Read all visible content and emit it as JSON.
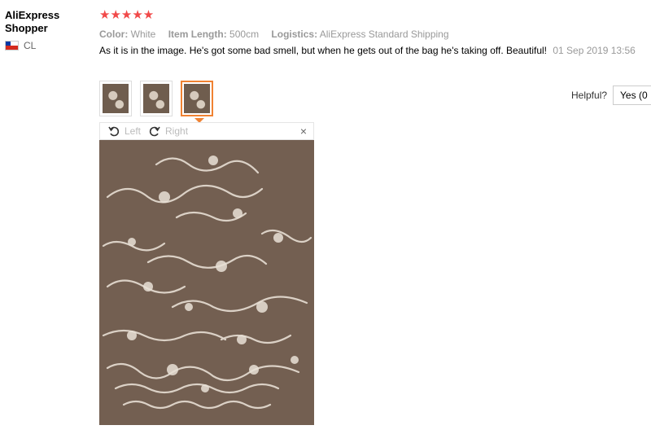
{
  "reviewer": {
    "name": "AliExpress Shopper",
    "country": "CL"
  },
  "review": {
    "stars": "★★★★★",
    "rating": 5,
    "props": [
      {
        "label": "Color:",
        "value": "White"
      },
      {
        "label": "Item Length:",
        "value": "500cm"
      },
      {
        "label": "Logistics:",
        "value": "AliExpress Standard Shipping"
      }
    ],
    "text": "As it is in the image. He's got some bad smell, but when he gets out of the bag he's taking off. Beautiful!",
    "date": "01 Sep 2019 13:56"
  },
  "helpful": {
    "label": "Helpful?",
    "yes": "Yes (0"
  },
  "viewer": {
    "left": "Left",
    "right": "Right",
    "close": "×"
  },
  "icons": [
    "flag-icon",
    "rotate-left-icon",
    "rotate-right-icon",
    "close-icon"
  ],
  "colors": {
    "star": "#f14949",
    "active_thumb": "#f08232"
  }
}
